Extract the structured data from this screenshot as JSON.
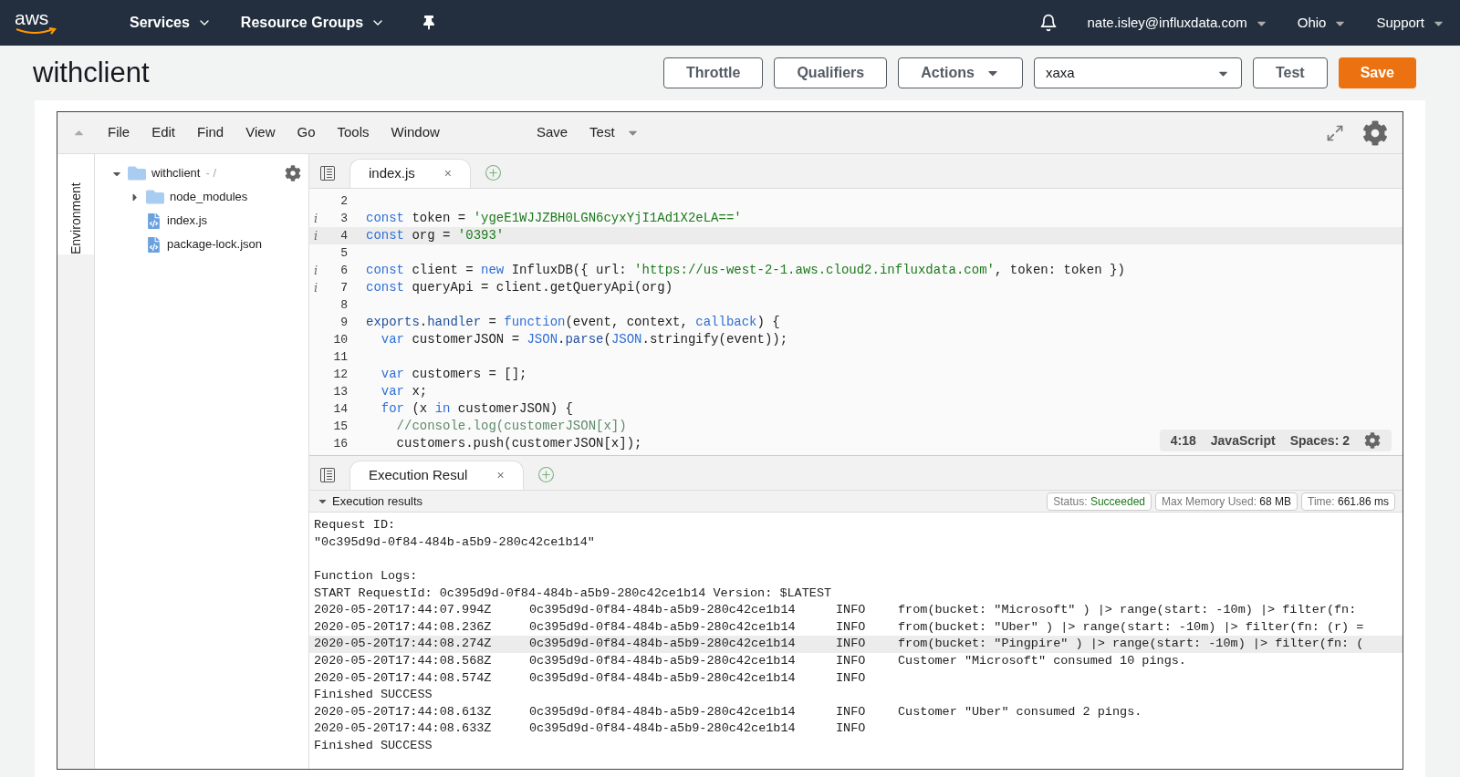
{
  "nav": {
    "logo": "aws",
    "services": "Services",
    "resource_groups": "Resource Groups",
    "account": "nate.isley@influxdata.com",
    "region": "Ohio",
    "support": "Support"
  },
  "header": {
    "title": "withclient",
    "controls": [
      {
        "kind": "plain",
        "label": "Throttle"
      },
      {
        "kind": "plain",
        "label": "Qualifiers"
      },
      {
        "kind": "dropdown",
        "label": "Actions"
      },
      {
        "kind": "select",
        "label": "xaxa"
      },
      {
        "kind": "plain",
        "label": "Test"
      },
      {
        "kind": "primary",
        "label": "Save"
      }
    ]
  },
  "ide": {
    "menu": [
      "File",
      "Edit",
      "Find",
      "View",
      "Go",
      "Tools",
      "Window"
    ],
    "toolbar": {
      "save": "Save",
      "test": "Test"
    },
    "side_tab": "Environment",
    "tree": [
      {
        "name": "withclient",
        "suffix": "- /",
        "kind": "folder",
        "expanded": true,
        "children": [
          {
            "name": "node_modules",
            "kind": "folder",
            "expanded": false
          },
          {
            "name": "index.js",
            "kind": "file"
          },
          {
            "name": "package-lock.json",
            "kind": "file"
          }
        ]
      }
    ],
    "editor_tab": {
      "label": "index.js",
      "close": "×",
      "selected": true
    },
    "code": [
      {
        "number": "2",
        "highlighted": false
      },
      {
        "number": "3",
        "info_mark": "i",
        "highlighted": false,
        "tokens": [
          {
            "kind": "kw",
            "text": "const"
          },
          {
            "kind": "plain",
            "text": " token = "
          },
          {
            "kind": "str",
            "text": "'ygeE1WJJZBH0LGN6cyxYjI1Ad1X2eLA=='"
          }
        ]
      },
      {
        "number": "4",
        "info_mark": "i",
        "highlighted": true,
        "tokens": [
          {
            "kind": "kw",
            "text": "const"
          },
          {
            "kind": "plain",
            "text": " org = "
          },
          {
            "kind": "str",
            "text": "'0393'"
          }
        ]
      },
      {
        "number": "5",
        "highlighted": false
      },
      {
        "number": "6",
        "info_mark": "i",
        "highlighted": false,
        "tokens": [
          {
            "kind": "kw",
            "text": "const"
          },
          {
            "kind": "plain",
            "text": " client = "
          },
          {
            "kind": "kw",
            "text": "new"
          },
          {
            "kind": "plain",
            "text": " InfluxDB({ url: "
          },
          {
            "kind": "str",
            "text": "'https://us-west-2-1.aws.cloud2.influxdata.com'"
          },
          {
            "kind": "plain",
            "text": ", token: token })"
          }
        ]
      },
      {
        "number": "7",
        "info_mark": "i",
        "highlighted": false,
        "tokens": [
          {
            "kind": "kw",
            "text": "const"
          },
          {
            "kind": "plain",
            "text": " queryApi = client.getQueryApi(org)"
          }
        ]
      },
      {
        "number": "8",
        "highlighted": false
      },
      {
        "number": "9",
        "highlighted": false,
        "tokens": [
          {
            "kind": "var",
            "text": "exports"
          },
          {
            "kind": "plain",
            "text": "."
          },
          {
            "kind": "var",
            "text": "handler"
          },
          {
            "kind": "plain",
            "text": " = "
          },
          {
            "kind": "kw",
            "text": "function"
          },
          {
            "kind": "plain",
            "text": "(event, context, "
          },
          {
            "kind": "kw",
            "text": "callback"
          },
          {
            "kind": "plain",
            "text": ") {"
          }
        ]
      },
      {
        "number": "10",
        "highlighted": false,
        "tokens": [
          {
            "kind": "kw",
            "text": "  var"
          },
          {
            "kind": "plain",
            "text": " customerJSON = "
          },
          {
            "kind": "kw",
            "text": "JSON"
          },
          {
            "kind": "plain",
            "text": "."
          },
          {
            "kind": "var",
            "text": "parse"
          },
          {
            "kind": "plain",
            "text": "("
          },
          {
            "kind": "kw",
            "text": "JSON"
          },
          {
            "kind": "plain",
            "text": ".stringify(event));"
          }
        ]
      },
      {
        "number": "11",
        "highlighted": false
      },
      {
        "number": "12",
        "highlighted": false,
        "tokens": [
          {
            "kind": "kw",
            "text": "  var"
          },
          {
            "kind": "plain",
            "text": " customers = [];"
          }
        ]
      },
      {
        "number": "13",
        "highlighted": false,
        "tokens": [
          {
            "kind": "kw",
            "text": "  var"
          },
          {
            "kind": "plain",
            "text": " x;"
          }
        ]
      },
      {
        "number": "14",
        "highlighted": false,
        "tokens": [
          {
            "kind": "kw",
            "text": "  for"
          },
          {
            "kind": "plain",
            "text": " (x "
          },
          {
            "kind": "kw",
            "text": "in"
          },
          {
            "kind": "plain",
            "text": " customerJSON) {"
          }
        ]
      },
      {
        "number": "15",
        "highlighted": false,
        "tokens": [
          {
            "kind": "cm",
            "text": "    //console.log(customerJSON[x])"
          }
        ]
      },
      {
        "number": "16",
        "highlighted": false,
        "tokens": [
          {
            "kind": "plain",
            "text": "    customers.push(customerJSON[x]);"
          }
        ]
      }
    ],
    "status": {
      "cursor": "4:18",
      "language": "JavaScript",
      "indent": "Spaces: 2"
    },
    "result_tab": {
      "label": "Execution Resul",
      "close": "×",
      "selected": true
    },
    "results": {
      "title": "Execution results",
      "expanded": true,
      "stats": [
        {
          "kind": "status",
          "label": "Status:",
          "value": "Succeeded"
        },
        {
          "kind": "metric",
          "label": "Max Memory Used:",
          "value": "68 MB"
        },
        {
          "kind": "metric",
          "label": "Time:",
          "value": "661.86 ms"
        }
      ],
      "log": [
        {
          "kind": "text",
          "text": "Request ID:",
          "highlighted": false
        },
        {
          "kind": "text",
          "text": "\"0c395d9d-0f84-484b-a5b9-280c42ce1b14\"",
          "highlighted": false
        },
        {
          "kind": "blank",
          "highlighted": false
        },
        {
          "kind": "text",
          "text": "Function Logs:",
          "highlighted": false
        },
        {
          "kind": "text",
          "text": "START RequestId: 0c395d9d-0f84-484b-a5b9-280c42ce1b14 Version: $LATEST",
          "highlighted": false
        },
        {
          "kind": "entry",
          "time": "2020-05-20T17:44:07.994Z",
          "request_id": "0c395d9d-0f84-484b-a5b9-280c42ce1b14",
          "level": "INFO",
          "message": "from(bucket: \"Microsoft\" ) |> range(start: -10m) |> filter(fn:",
          "highlighted": false
        },
        {
          "kind": "entry",
          "time": "2020-05-20T17:44:08.236Z",
          "request_id": "0c395d9d-0f84-484b-a5b9-280c42ce1b14",
          "level": "INFO",
          "message": "from(bucket: \"Uber\" ) |> range(start: -10m) |> filter(fn: (r) =",
          "highlighted": false
        },
        {
          "kind": "entry",
          "time": "2020-05-20T17:44:08.274Z",
          "request_id": "0c395d9d-0f84-484b-a5b9-280c42ce1b14",
          "level": "INFO",
          "message": "from(bucket: \"Pingpire\" ) |> range(start: -10m) |> filter(fn: (",
          "highlighted": true
        },
        {
          "kind": "entry",
          "time": "2020-05-20T17:44:08.568Z",
          "request_id": "0c395d9d-0f84-484b-a5b9-280c42ce1b14",
          "level": "INFO",
          "message": "Customer \"Microsoft\" consumed 10 pings.",
          "highlighted": false
        },
        {
          "kind": "entry",
          "time": "2020-05-20T17:44:08.574Z",
          "request_id": "0c395d9d-0f84-484b-a5b9-280c42ce1b14",
          "level": "INFO",
          "highlighted": false
        },
        {
          "kind": "text",
          "text": "Finished SUCCESS",
          "highlighted": false
        },
        {
          "kind": "entry",
          "time": "2020-05-20T17:44:08.613Z",
          "request_id": "0c395d9d-0f84-484b-a5b9-280c42ce1b14",
          "level": "INFO",
          "message": "Customer \"Uber\" consumed 2 pings.",
          "highlighted": false
        },
        {
          "kind": "entry",
          "time": "2020-05-20T17:44:08.633Z",
          "request_id": "0c395d9d-0f84-484b-a5b9-280c42ce1b14",
          "level": "INFO",
          "highlighted": false
        },
        {
          "kind": "text",
          "text": "Finished SUCCESS",
          "highlighted": false
        }
      ]
    }
  }
}
